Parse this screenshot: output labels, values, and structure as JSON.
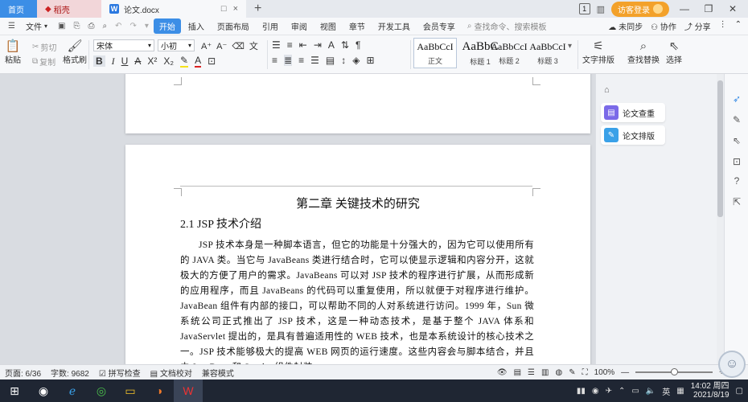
{
  "titlebar": {
    "tabs": [
      {
        "label": "首页"
      },
      {
        "label": "稻壳"
      },
      {
        "label": "论文.docx"
      }
    ],
    "new_tab": "+",
    "doc_tab_controls": [
      "□",
      "×"
    ],
    "badge": "1",
    "login_label": "访客登录",
    "window_controls": [
      "—",
      "❐",
      "✕"
    ]
  },
  "menubar": {
    "file": "文件",
    "items": [
      "开始",
      "插入",
      "页面布局",
      "引用",
      "审阅",
      "视图",
      "章节",
      "开发工具",
      "会员专享"
    ],
    "search_placeholder": "查找命令、搜索模板",
    "right": [
      "未同步",
      "协作",
      "分享"
    ]
  },
  "ribbon": {
    "paste": "粘贴",
    "cut": "剪切",
    "copy": "复制",
    "format_painter": "格式刷",
    "font_name": "宋体",
    "font_size": "小初",
    "styles": [
      {
        "preview": "AaBbCcI",
        "label": "正文"
      },
      {
        "preview": "AaBbC",
        "label": "标题 1"
      },
      {
        "preview": "AaBbCcI",
        "label": "标题 2"
      },
      {
        "preview": "AaBbCcI",
        "label": "标题 3"
      }
    ],
    "text_layout": "文字排版",
    "find_replace": "查找替换",
    "select": "选择"
  },
  "document": {
    "chapter_title": "第二章  关键技术的研究",
    "section_title": "2.1 JSP 技术介绍",
    "paragraph": "JSP 技术本身是一种脚本语言，但它的功能是十分强大的，因为它可以使用所有的 JAVA 类。当它与 JavaBeans 类进行结合时，它可以使显示逻辑和内容分开，这就极大的方便了用户的需求。JavaBeans 可以对 JSP 技术的程序进行扩展，从而形成新的应用程序，而且 JavaBeans 的代码可以重复使用，所以就便于对程序进行维护。JavaBean 组件有内部的接口，可以帮助不同的人对系统进行访问。1999 年，Sun 微系统公司正式推出了 JSP 技术，这是一种动态技术，是基于整个 JAVA 体系和 JavaServlet 提出的，是具有普遍适用性的 WEB 技术，也是本系统设计的核心技术之一。JSP 技术能够极大的提高 WEB 网页的运行速度。这些内容会与脚本结合，并且由 JavaBean 和 Servlet 组件封装"
  },
  "sidepanel": {
    "items": [
      {
        "label": "论文查重",
        "color": "#7b6ae8"
      },
      {
        "label": "论文排版",
        "color": "#3aa1e8"
      }
    ]
  },
  "statusbar": {
    "page": "页面: 6/36",
    "word_count": "字数: 9682",
    "spell_check": "拼写检查",
    "doc_proof": "文档校对",
    "compat_mode": "兼容模式",
    "zoom": "100%",
    "zoom_level": 0.5
  },
  "taskbar": {
    "lang": "英",
    "time": "14:02 周四",
    "date": "2021/8/19"
  }
}
